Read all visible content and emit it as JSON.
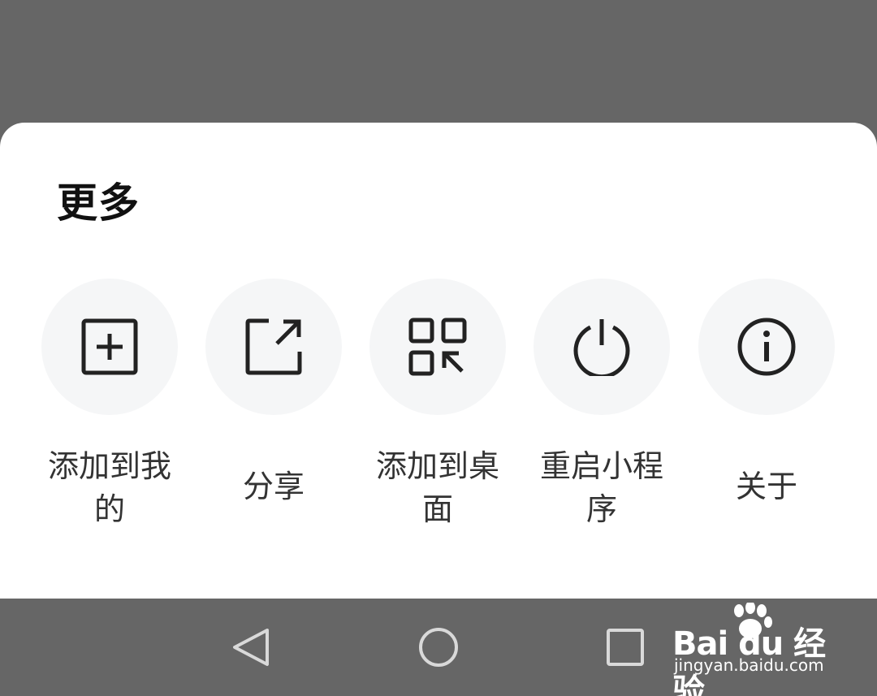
{
  "sheet": {
    "title": "更多",
    "actions": [
      {
        "label": "添加到我的",
        "icon": "add-square-icon"
      },
      {
        "label": "分享",
        "icon": "share-icon"
      },
      {
        "label": "添加到桌面",
        "icon": "add-to-desktop-icon"
      },
      {
        "label": "重启小程序",
        "icon": "power-icon"
      },
      {
        "label": "关于",
        "icon": "info-icon"
      }
    ]
  },
  "navbar": {
    "buttons": [
      "back-triangle-icon",
      "home-circle-icon",
      "recents-square-icon"
    ]
  },
  "watermark": {
    "brand": "Bai du 经验",
    "url": "jingyan.baidu.com"
  },
  "colors": {
    "backdrop": "#666666",
    "sheet": "#ffffff",
    "icon_bg": "#f5f6f7",
    "icon": "#222222",
    "label": "#333333"
  }
}
